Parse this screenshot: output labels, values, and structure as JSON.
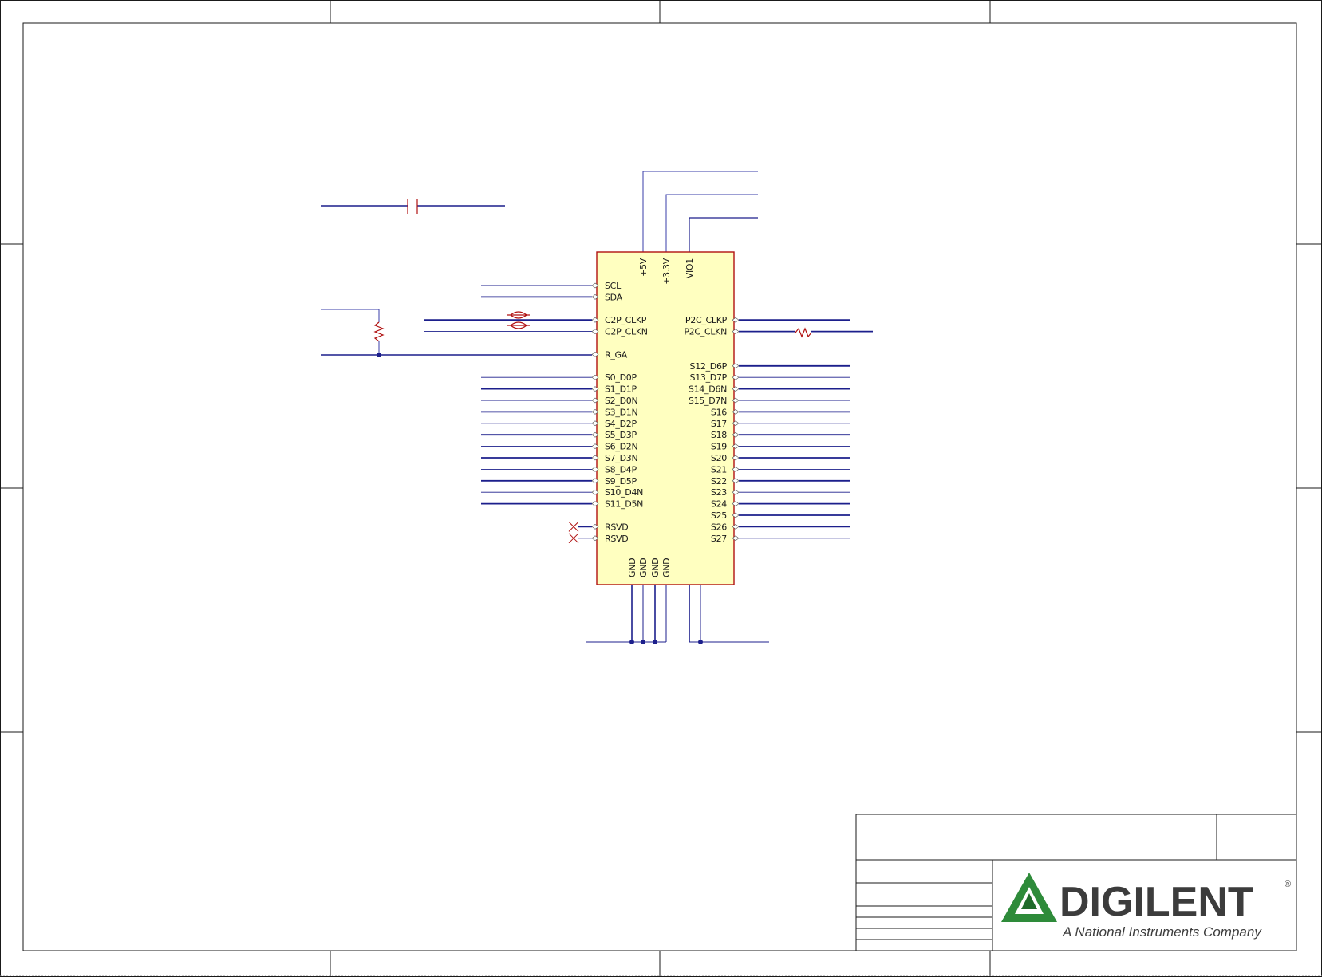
{
  "connector": {
    "top_pins": [
      "+5V",
      "+3.3V",
      "VIO1"
    ],
    "bottom_pins": [
      "GND",
      "GND",
      "GND",
      "GND"
    ],
    "left_pins": [
      {
        "label": "SCL",
        "row": 0
      },
      {
        "label": "SDA",
        "row": 1
      },
      {
        "label": "C2P_CLKP",
        "row": 3
      },
      {
        "label": "C2P_CLKN",
        "row": 4
      },
      {
        "label": "R_GA",
        "row": 6
      },
      {
        "label": "S0_D0P",
        "row": 8
      },
      {
        "label": "S1_D1P",
        "row": 9
      },
      {
        "label": "S2_D0N",
        "row": 10
      },
      {
        "label": "S3_D1N",
        "row": 11
      },
      {
        "label": "S4_D2P",
        "row": 12
      },
      {
        "label": "S5_D3P",
        "row": 13
      },
      {
        "label": "S6_D2N",
        "row": 14
      },
      {
        "label": "S7_D3N",
        "row": 15
      },
      {
        "label": "S8_D4P",
        "row": 16
      },
      {
        "label": "S9_D5P",
        "row": 17
      },
      {
        "label": "S10_D4N",
        "row": 18
      },
      {
        "label": "S11_D5N",
        "row": 19
      },
      {
        "label": "RSVD",
        "row": 21
      },
      {
        "label": "RSVD",
        "row": 22
      }
    ],
    "right_pins": [
      {
        "label": "P2C_CLKP",
        "row": 3
      },
      {
        "label": "P2C_CLKN",
        "row": 4
      },
      {
        "label": "S12_D6P",
        "row": 7
      },
      {
        "label": "S13_D7P",
        "row": 8
      },
      {
        "label": "S14_D6N",
        "row": 9
      },
      {
        "label": "S15_D7N",
        "row": 10
      },
      {
        "label": "S16",
        "row": 11
      },
      {
        "label": "S17",
        "row": 12
      },
      {
        "label": "S18",
        "row": 13
      },
      {
        "label": "S19",
        "row": 14
      },
      {
        "label": "S20",
        "row": 15
      },
      {
        "label": "S21",
        "row": 16
      },
      {
        "label": "S22",
        "row": 17
      },
      {
        "label": "S23",
        "row": 18
      },
      {
        "label": "S24",
        "row": 19
      },
      {
        "label": "S25",
        "row": 20
      },
      {
        "label": "S26",
        "row": 21
      },
      {
        "label": "S27",
        "row": 22
      }
    ]
  },
  "title_block": {
    "logo_name": "DIGILENT",
    "logo_registered": "®",
    "logo_tagline": "A National Instruments Company"
  },
  "colors": {
    "wire": "#1c1f8c",
    "component_outline": "#b01010",
    "connector_fill": "#ffffc0"
  }
}
